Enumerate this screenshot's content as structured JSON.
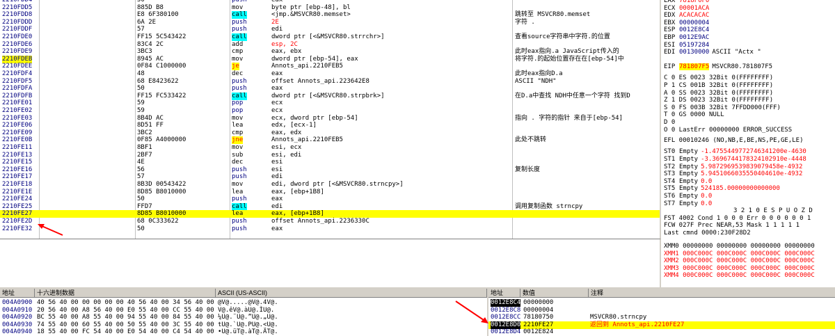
{
  "disasm": {
    "rows": [
      {
        "addr": "2210FDD4",
        "hex": "50",
        "mn": "push",
        "op": "eax",
        "cm": ""
      },
      {
        "addr": "2210FDD5",
        "hex": "885D B8",
        "mn": "mov",
        "op": "byte ptr [ebp-48], bl",
        "cm": ""
      },
      {
        "addr": "2210FDD8",
        "hex": "E8 6F380100",
        "mn": "call",
        "op": "<jmp.&MSVCR80.memset>",
        "cm": "跳转至 MSVCR80.memset"
      },
      {
        "addr": "2210FDDD",
        "hex": "6A 2E",
        "mn": "push",
        "op": "2E",
        "cm": "字符 ."
      },
      {
        "addr": "2210FDDF",
        "hex": "57",
        "mn": "push",
        "op": "edi",
        "cm": ""
      },
      {
        "addr": "2210FDE0",
        "hex": "FF15 5C543422",
        "mn": "call",
        "op": "dword ptr [<&MSVCR80.strrchr>]",
        "cm": "查看source字符串中字符.的位置"
      },
      {
        "addr": "2210FDE6",
        "hex": "83C4 2C",
        "mn": "add",
        "op": "esp, 2C",
        "cm": ""
      },
      {
        "addr": "2210FDE9",
        "hex": "3BC3",
        "mn": "cmp",
        "op": "eax, ebx",
        "cm": "此时eax指向.a JavaScript传入的"
      },
      {
        "addr": "2210FDEB",
        "hex": "8945 AC",
        "mn": "mov",
        "op": "dword ptr [ebp-54], eax",
        "cm": "将字符.的起始位置存在在[ebp-54]中"
      },
      {
        "addr": "2210FDEE",
        "hex": "0F84 C1000000",
        "mn": "je",
        "op": "Annots_api.2210FEB5",
        "cm": ""
      },
      {
        "addr": "2210FDF4",
        "hex": "48",
        "mn": "dec",
        "op": "eax",
        "cm": "此时eax指向D.a"
      },
      {
        "addr": "2210FDF5",
        "hex": "68 E8423622",
        "mn": "push",
        "op": "offset Annots_api.223642E8",
        "cm": "ASCII \"NDH\""
      },
      {
        "addr": "2210FDFA",
        "hex": "50",
        "mn": "push",
        "op": "eax",
        "cm": ""
      },
      {
        "addr": "2210FDFB",
        "hex": "FF15 FC533422",
        "mn": "call",
        "op": "dword ptr [<&MSVCR80.strpbrk>]",
        "cm": "在D.a中查找 NDH中任意一个字符 找到D"
      },
      {
        "addr": "2210FE01",
        "hex": "59",
        "mn": "pop",
        "op": "ecx",
        "cm": ""
      },
      {
        "addr": "2210FE02",
        "hex": "59",
        "mn": "pop",
        "op": "ecx",
        "cm": ""
      },
      {
        "addr": "2210FE03",
        "hex": "8B4D AC",
        "mn": "mov",
        "op": "ecx, dword ptr [ebp-54]",
        "cm": "指向 . 字符的指针  来自于[ebp-54]"
      },
      {
        "addr": "2210FE06",
        "hex": "8D51 FF",
        "mn": "lea",
        "op": "edx, [ecx-1]",
        "cm": ""
      },
      {
        "addr": "2210FE09",
        "hex": "3BC2",
        "mn": "cmp",
        "op": "eax, edx",
        "cm": ""
      },
      {
        "addr": "2210FE0B",
        "hex": "0F85 A4000000",
        "mn": "jne",
        "op": "Annots_api.2210FEB5",
        "cm": "此处不跳转"
      },
      {
        "addr": "2210FE11",
        "hex": "8BF1",
        "mn": "mov",
        "op": "esi, ecx",
        "cm": ""
      },
      {
        "addr": "2210FE13",
        "hex": "2BF7",
        "mn": "sub",
        "op": "esi, edi",
        "cm": ""
      },
      {
        "addr": "2210FE15",
        "hex": "4E",
        "mn": "dec",
        "op": "esi",
        "cm": ""
      },
      {
        "addr": "2210FE16",
        "hex": "56",
        "mn": "push",
        "op": "esi",
        "cm": "复制长度"
      },
      {
        "addr": "2210FE17",
        "hex": "57",
        "mn": "push",
        "op": "edi",
        "cm": ""
      },
      {
        "addr": "2210FE18",
        "hex": "8B3D 00543422",
        "mn": "mov",
        "op": "edi, dword ptr [<&MSVCR80.strncpy>]",
        "cm": ""
      },
      {
        "addr": "2210FE1E",
        "hex": "8D85 B8010000",
        "mn": "lea",
        "op": "eax, [ebp+1B8]",
        "cm": ""
      },
      {
        "addr": "2210FE24",
        "hex": "50",
        "mn": "push",
        "op": "eax",
        "cm": ""
      },
      {
        "addr": "2210FE25",
        "hex": "FFD7",
        "mn": "call",
        "op": "edi",
        "cm": "调用复制函数  strncpy"
      },
      {
        "addr": "2210FE27",
        "hex": "8D85 B8010000",
        "mn": "lea",
        "op": "eax, [ebp+1B8]",
        "cm": ""
      },
      {
        "addr": "2210FE2D",
        "hex": "68 0C333622",
        "mn": "push",
        "op": "offset Annots_api.2236330C",
        "cm": ""
      },
      {
        "addr": "2210FE32",
        "hex": "50",
        "mn": "push",
        "op": "eax",
        "cm": ""
      }
    ]
  },
  "registers": {
    "gp": [
      {
        "n": "EAX",
        "v": "7818F0F0",
        "s": ""
      },
      {
        "n": "ECX",
        "v": "00001ACA",
        "s": ""
      },
      {
        "n": "EDX",
        "v": "ACACACAC",
        "s": ""
      },
      {
        "n": "EBX",
        "v": "00000004",
        "s": ""
      },
      {
        "n": "ESP",
        "v": "0012E8C4",
        "s": ""
      },
      {
        "n": "EBP",
        "v": "0012E9AC",
        "s": ""
      },
      {
        "n": "ESI",
        "v": "05197284",
        "s": ""
      },
      {
        "n": "EDI",
        "v": "00130000",
        "s": "ASCII \"Actx \""
      }
    ],
    "eip": {
      "n": "EIP",
      "v": "781807F5",
      "s": "MSVCR80.781807F5"
    },
    "segs": [
      "C 0  ES 0023 32Bit 0(FFFFFFFF)",
      "P 1  CS 001B 32Bit 0(FFFFFFFF)",
      "A 0  SS 0023 32Bit 0(FFFFFFFF)",
      "Z 1  DS 0023 32Bit 0(FFFFFFFF)",
      "S 0  FS 003B 32Bit 7FFDD000(FFF)",
      "T 0  GS 0000 NULL",
      "D 0",
      "O 0  LastErr 00000000 ERROR_SUCCESS"
    ],
    "efl": "EFL 00010246 (NO,NB,E,BE,NS,PE,GE,LE)",
    "fpu": [
      {
        "n": "ST0",
        "t": "Empty",
        "v": "-1.4755449772746341200e-4630"
      },
      {
        "n": "ST1",
        "t": "Empty",
        "v": "-3.3696744178324102910e-4448"
      },
      {
        "n": "ST2",
        "t": "Empty",
        "v": "5.9872969539839079458e-4932"
      },
      {
        "n": "ST3",
        "t": "Empty",
        "v": "5.9451066035550404610e-4932"
      },
      {
        "n": "ST4",
        "t": "Empty",
        "v": "0.0"
      },
      {
        "n": "ST5",
        "t": "Empty",
        "v": "524185.00000000000000"
      },
      {
        "n": "ST6",
        "t": "Empty",
        "v": "0.0"
      },
      {
        "n": "ST7",
        "t": "Empty",
        "v": "0.0"
      }
    ],
    "fpu_flags_hdr": "3 2 1 0      E S P U O Z D",
    "fst": "FST 4002  Cond 1 0 0 0  Err 0 0 0 0 0 0 1",
    "fcw": "FCW 027F  Prec NEAR,53  Mask    1 1 1 1 1",
    "last_cmd": "Last cmnd 0000:230F28D2",
    "xmm": [
      "XMM0 00000000 00000000 00000000 00000000",
      "XMM1 000C000C 000C000C 000C000C 000C000C",
      "XMM2 000C000C 000C000C 000C000C 000C000C",
      "XMM3 000C000C 000C000C 000C000C 000C000C",
      "XMM4 000C000C 000C000C 000C000C 000C000C"
    ]
  },
  "dump": {
    "headers": {
      "addr": "地址",
      "hex": "十六进制数据",
      "ascii": "ASCII (US-ASCII)"
    },
    "rows": [
      {
        "addr": "004A0900",
        "hex": "40 56 40 00 00 00 00 00 40 56 40 00 34 56 40 00",
        "ascii": "@V@.....@V@.4V@."
      },
      {
        "addr": "004A0910",
        "hex": "20 56 40 00 A8 56 40 00 E0 55 40 00 CC 55 40 00",
        "ascii": " V@.êV@.àU@.ÌU@."
      },
      {
        "addr": "004A0920",
        "hex": "BC 55 40 00 A8 55 40 00 94 55 40 00 84 55 40 00",
        "ascii": "¼U@.¨U@.”U@.„U@."
      },
      {
        "addr": "004A0930",
        "hex": "74 55 40 00 60 55 40 00 50 55 40 00 3C 55 40 00",
        "ascii": "tU@.`U@.PU@.<U@."
      },
      {
        "addr": "004A0940",
        "hex": "18 55 40 00 FC 54 40 00 E0 54 40 00 C4 54 40 00",
        "ascii": "•U@.üT@.àT@.ÄT@."
      }
    ]
  },
  "stack": {
    "headers": {
      "addr": "地址",
      "val": "数值",
      "cm": "注释"
    },
    "rows": [
      {
        "addr": "0012E8C4",
        "val": "00000000",
        "cm": ""
      },
      {
        "addr": "0012E8C8",
        "val": "00000004",
        "cm": ""
      },
      {
        "addr": "0012E8CC",
        "val": "78180750",
        "cm": "MSVCR80.strncpy"
      },
      {
        "addr": "0012E8D0",
        "val": "2210FE27",
        "cm": "返回到 Annots_api.2210FE27"
      },
      {
        "addr": "0012E8D4",
        "val": "0012E824",
        "cm": ""
      }
    ]
  },
  "colors": {
    "accent": "#ffff00",
    "call": "#00ffff",
    "jump": "#ff0000",
    "arrow": "#ff0000"
  }
}
